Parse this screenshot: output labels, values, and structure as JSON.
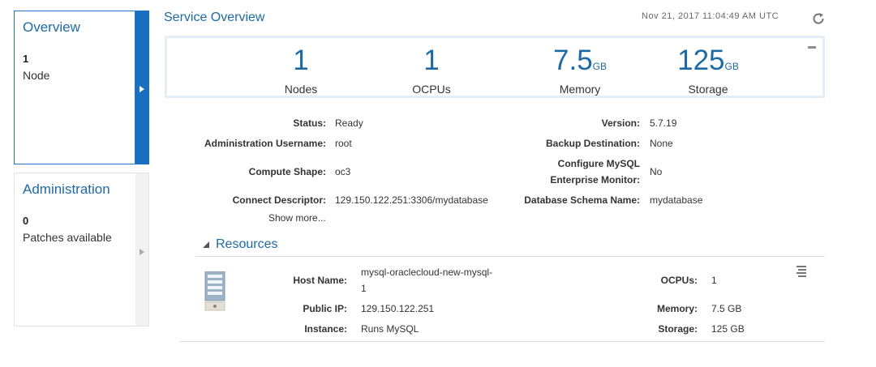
{
  "tiles": {
    "overview": {
      "title": "Overview",
      "count": "1",
      "label": "Node"
    },
    "administration": {
      "title": "Administration",
      "count": "0",
      "label": "Patches available"
    }
  },
  "header": {
    "title": "Service Overview",
    "timestamp": "Nov 21, 2017 11:04:49 AM UTC"
  },
  "metrics": [
    {
      "value": "1",
      "unit": "",
      "label": "Nodes"
    },
    {
      "value": "1",
      "unit": "",
      "label": "OCPUs"
    },
    {
      "value": "7.5",
      "unit": "GB",
      "label": "Memory"
    },
    {
      "value": "125",
      "unit": "GB",
      "label": "Storage"
    }
  ],
  "details": {
    "status_label": "Status:",
    "status": "Ready",
    "admin_user_label": "Administration Username:",
    "admin_user": "root",
    "compute_shape_label": "Compute Shape:",
    "compute_shape": "oc3",
    "connect_label": "Connect Descriptor:",
    "connect": "129.150.122.251:3306/mydatabase",
    "version_label": "Version:",
    "version": "5.7.19",
    "backup_label": "Backup Destination:",
    "backup": "None",
    "monitor_label_1": "Configure MySQL",
    "monitor_label_2": "Enterprise Monitor:",
    "monitor": "No",
    "schema_label": "Database Schema Name:",
    "schema": "mydatabase",
    "show_more": "Show more..."
  },
  "resources": {
    "title": "Resources",
    "host_label": "Host Name:",
    "host_line1": "mysql-oraclecloud-new-mysql-",
    "host_line2": "1",
    "ip_label": "Public IP:",
    "ip": "129.150.122.251",
    "instance_label": "Instance:",
    "instance": "Runs MySQL",
    "ocpus_label": "OCPUs:",
    "ocpus": "1",
    "memory_label": "Memory:",
    "memory": "7.5 GB",
    "storage_label": "Storage:",
    "storage": "125 GB"
  },
  "colors": {
    "accent": "#1d6aa5",
    "tile_active": "#1a6fc0"
  },
  "icons": [
    "chevron-right-icon",
    "refresh-icon",
    "collapse-icon",
    "server-icon",
    "menu-icon",
    "triangle-down-icon"
  ]
}
